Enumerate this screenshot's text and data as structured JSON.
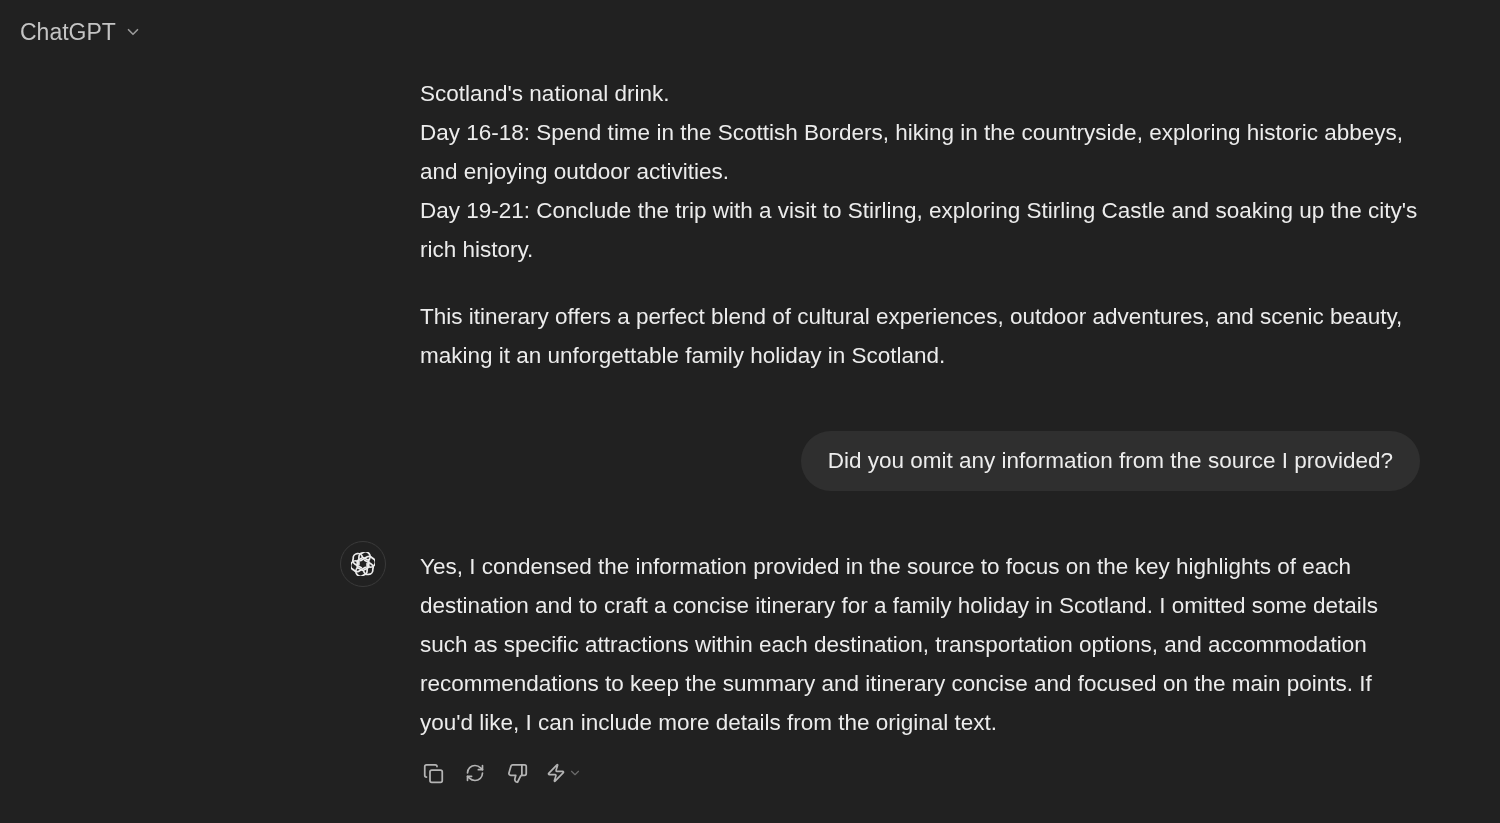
{
  "header": {
    "title": "ChatGPT"
  },
  "messages": [
    {
      "kind": "assistant",
      "avatar": false,
      "toolbar": false,
      "paragraphs": [
        {
          "lines": [
            "Scotland's national drink.",
            "Day 16-18: Spend time in the Scottish Borders, hiking in the countryside, exploring historic abbeys, and enjoying outdoor activities.",
            "Day 19-21: Conclude the trip with a visit to Stirling, exploring Stirling Castle and soaking up the city's rich history."
          ]
        },
        {
          "lines": [
            "This itinerary offers a perfect blend of cultural experiences, outdoor adventures, and scenic beauty, making it an unforgettable family holiday in Scotland."
          ]
        }
      ]
    },
    {
      "kind": "user",
      "text": "Did you omit any information from the source I provided?"
    },
    {
      "kind": "assistant",
      "avatar": true,
      "toolbar": true,
      "paragraphs": [
        {
          "lines": [
            "Yes, I condensed the information provided in the source to focus on the key highlights of each destination and to craft a concise itinerary for a family holiday in Scotland. I omitted some details such as specific attractions within each destination, transportation options, and accommodation recommendations to keep the summary and itinerary concise and focused on the main points. If you'd like, I can include more details from the original text."
          ]
        }
      ]
    }
  ]
}
